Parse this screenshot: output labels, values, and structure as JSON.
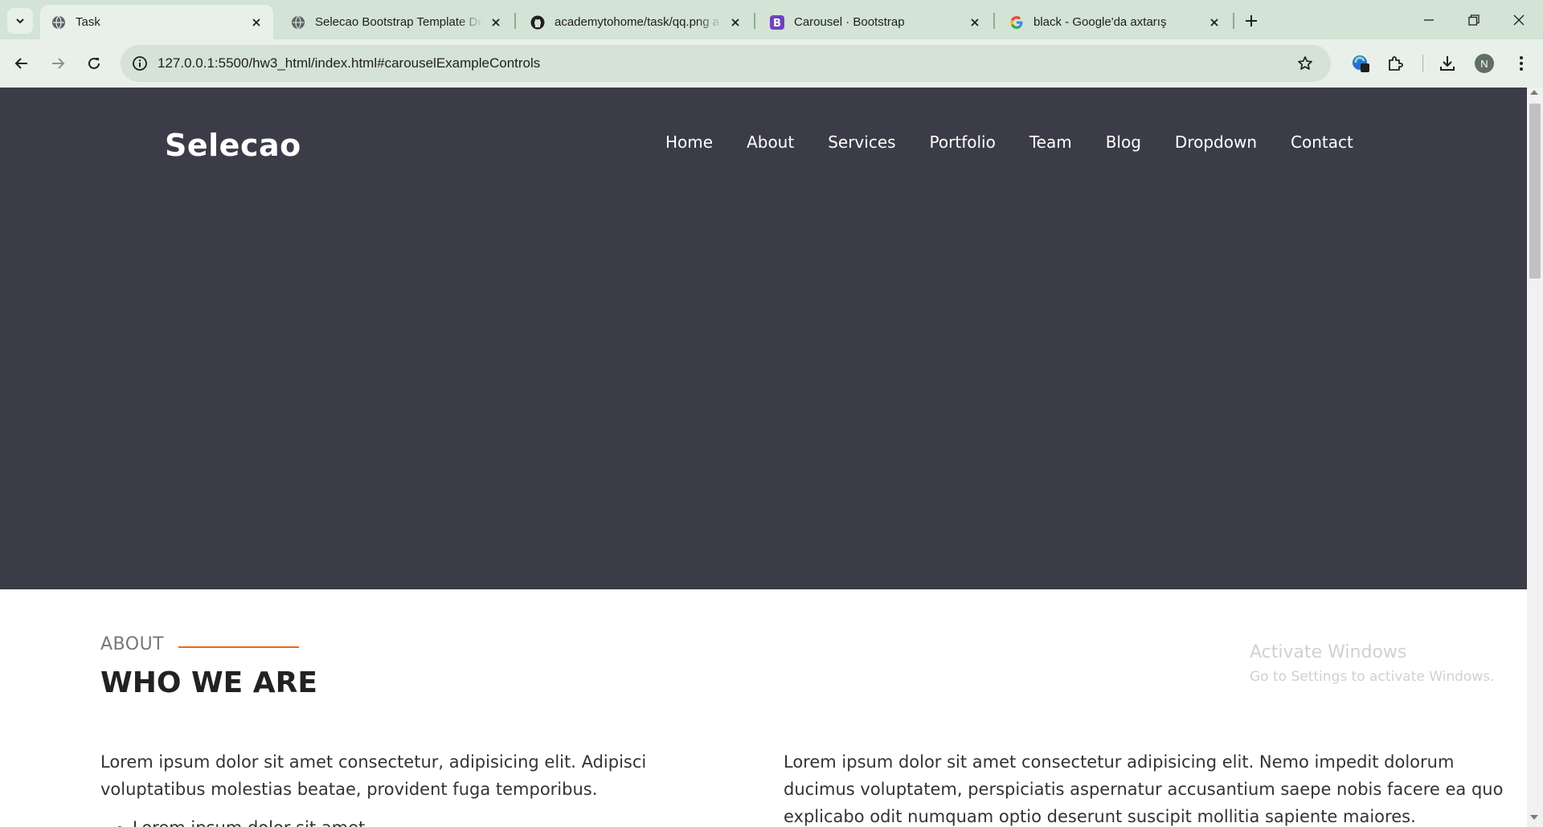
{
  "browser": {
    "tabs": [
      {
        "title": "Task",
        "favicon": "globe-icon",
        "active": true
      },
      {
        "title": "Selecao Bootstrap Template De",
        "favicon": "globe-icon",
        "active": false
      },
      {
        "title": "academytohome/task/qq.png a",
        "favicon": "github-icon",
        "active": false
      },
      {
        "title": "Carousel · Bootstrap",
        "favicon": "bootstrap-icon",
        "active": false
      },
      {
        "title": "black - Google'da axtarış",
        "favicon": "google-icon",
        "active": false
      }
    ],
    "url": "127.0.0.1:5500/hw3_html/index.html#carouselExampleControls",
    "profile_initial": "N"
  },
  "page": {
    "brand": "Selecao",
    "nav": [
      "Home",
      "About",
      "Services",
      "Portfolio",
      "Team",
      "Blog",
      "Dropdown",
      "Contact"
    ],
    "about": {
      "kicker": "ABOUT",
      "title": "WHO WE ARE",
      "left_text": "Lorem ipsum dolor sit amet consectetur, adipisicing elit. Adipisci voluptatibus molestias beatae, provident fuga temporibus.",
      "left_list": [
        "Lorem ipsum dolor sit amet"
      ],
      "right_text": "Lorem ipsum dolor sit amet consectetur adipisicing elit. Nemo impedit dolorum ducimus voluptatem, perspiciatis aspernatur accusantium saepe nobis facere ea quo explicabo odit numquam optio deserunt suscipit mollitia sapiente maiores."
    }
  },
  "os_watermark": {
    "line1": "Activate Windows",
    "line2": "Go to Settings to activate Windows."
  },
  "colors": {
    "hero_bg": "#3c3c48",
    "accent": "#e96b14",
    "chrome_bg": "#d3e3d5"
  }
}
